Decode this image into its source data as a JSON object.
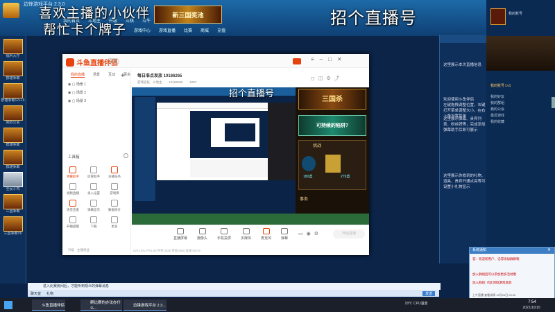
{
  "overlay": {
    "line1": "喜欢主播的小伙伴",
    "line2": "帮忙卡个牌子",
    "right_title": "招个直播号"
  },
  "topbar": {
    "window_title": "边锋游戏平台 2.3.0",
    "banner": "新三国奖池",
    "nav": [
      "我的首页",
      "斗地主",
      "升级",
      "斗棋",
      "斗牛",
      "掼蛋",
      "更多游戏"
    ],
    "nav2": [
      "游戏中心",
      "游戏直播",
      "比赛",
      "商城",
      "充值"
    ]
  },
  "left_items": [
    "福利大厅",
    "群雄争霸",
    "群雄争霸12+16",
    "我的公会",
    "群雄争霸",
    "群雄争霸",
    "全民斗鸡",
    "三国争霸",
    "三国争霸V6"
  ],
  "app": {
    "brand": "斗鱼直播伴侣",
    "user": "主播",
    "tabs": [
      "我的直播",
      "场景",
      "互动",
      "更多"
    ],
    "scenes": [
      "场景 1",
      "场景 2",
      "场景 3"
    ],
    "tools_label": "工具箱",
    "tools": [
      "弹幕助手",
      "房管助手",
      "主播任务",
      "视频直播",
      "录入设置",
      "游戏库",
      "语音连麦",
      "弹幕显示",
      "数据统计",
      "开播提醒",
      "下载",
      "更多"
    ],
    "room_title": "每日准点发放 10186265",
    "room_meta": [
      "游戏竞技 · 斗地主",
      "10186265",
      "6297"
    ],
    "bottom_buttons": [
      "直播屏幕",
      "摄像头",
      "手机投屏",
      "多媒体",
      "麦克风",
      "弹幕"
    ],
    "stats": "CPU:3%   FPS:30   内存:2GB   带宽:0KB   丢帧:0/279",
    "start_button": "开始直播",
    "notice": "升级 · 主播权益"
  },
  "preview": {
    "game_title": "三国杀",
    "game_title2": "可持续的陷阱?",
    "battle_label": "挑战",
    "label2": "事务",
    "count_a": "180盏",
    "count_b": "279盏"
  },
  "right_text": {
    "rp1": "这里展示本次直播信息",
    "rp2": "欢迎使用斗鱼伴侣\n左键拖拽调整位置，右键打开菜单调整大小，在右上角设置菜单",
    "rp3": "这里展示弹幕、贵宾列表、粉丝牌等，完成添加弹幕助手后即可展示",
    "rp4": "这里展示你收到的礼物、道具、贵宾开通点亮等可设置小礼物显示"
  },
  "far_right": {
    "user": "我的账号",
    "level": "我的账号 Lv1",
    "items": [
      "我的好友",
      "我的群组",
      "我的公会",
      "最近游戏",
      "我的收藏"
    ]
  },
  "status_line": "进入比赛房间后，才能听到观众的弹幕消息",
  "chat_bar": [
    "聊天室",
    "礼物",
    "发送"
  ],
  "notice_box": {
    "title": "系统通知",
    "line1": "官：欢迎新用户，记得添加群聊噢",
    "line2": "加入群组后可以参加更多活动哦",
    "line3": "加入群组: 点此领取游戏道具",
    "foot": "上午直播 查看详情 12月26日 00:30"
  },
  "taskbar": {
    "items": [
      "斗鱼直播伴侣",
      "群比赛的办法办什么...",
      "边锋游戏平台 2.3..."
    ],
    "weather": "18℃ CPU温度",
    "time": "7:54",
    "date": "2021/10/10"
  },
  "colors": {
    "accent": "#e8420e",
    "top": "#1d6aa8",
    "panel": "#0d2f5a"
  }
}
